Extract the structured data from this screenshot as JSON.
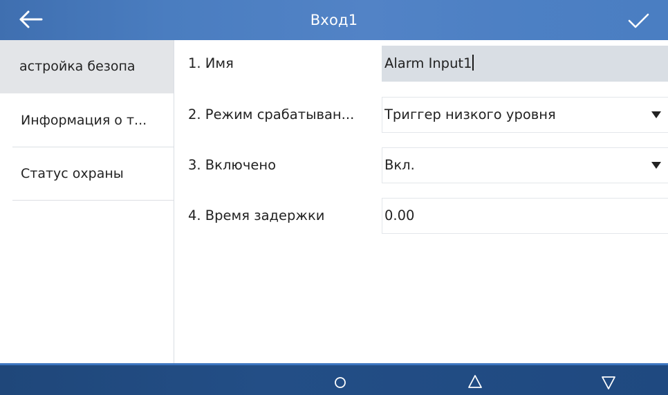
{
  "header": {
    "title": "Вход1",
    "back_icon": "arrow-left-icon",
    "confirm_icon": "checkmark-icon"
  },
  "sidebar": {
    "items": [
      {
        "label": "астройка безопа",
        "active": true
      },
      {
        "label": "Информация о т...",
        "active": false
      },
      {
        "label": "Статус охраны",
        "active": false
      }
    ]
  },
  "form": {
    "rows": [
      {
        "label": "1. Имя",
        "value": "Alarm Input1",
        "type": "text-input"
      },
      {
        "label": "2. Режим срабатыван...",
        "value": "Триггер низкого уровня",
        "type": "dropdown"
      },
      {
        "label": "3. Включено",
        "value": "Вкл.",
        "type": "dropdown"
      },
      {
        "label": "4. Время задержки",
        "value": "0.00",
        "type": "text-input"
      }
    ]
  },
  "navbar": {
    "icons": [
      "home-circle-icon",
      "up-triangle-icon",
      "down-triangle-icon"
    ]
  },
  "colors": {
    "titlebar": "#4a7dc0",
    "navbar": "#234e86",
    "active_menu_bg": "#e3e5e8",
    "filled_field_bg": "#d9dee4"
  }
}
